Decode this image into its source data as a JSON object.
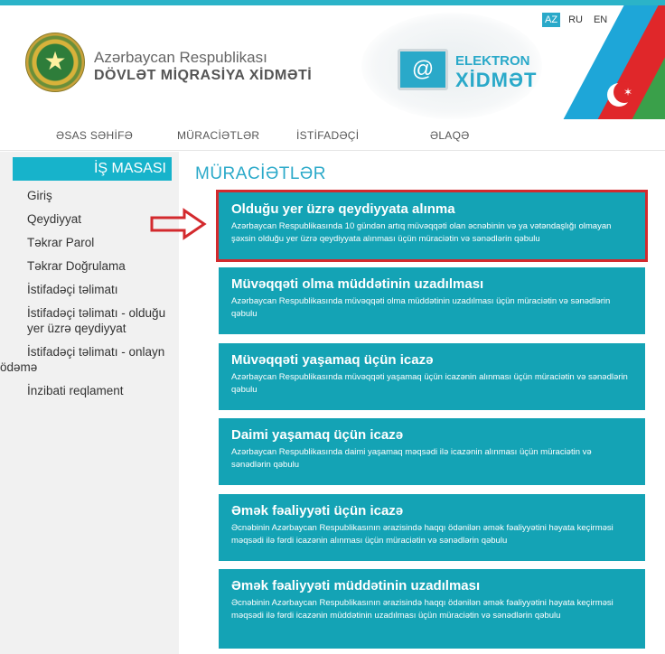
{
  "header": {
    "org_line1": "Azərbaycan Respublikası",
    "org_line2": "DÖVLƏT MİQRASİYA XİDMƏTİ",
    "elektron_line1": "ELEKTRON",
    "elektron_line2": "XİDMƏT",
    "monitor_symbol": "@",
    "languages": [
      "AZ",
      "RU",
      "EN"
    ],
    "active_language": "AZ",
    "flag_colors": [
      "#1ea6d8",
      "#e0272a",
      "#3aa04a"
    ]
  },
  "nav": {
    "items": [
      "ƏSAS SƏHİFƏ",
      "MÜRACİƏTLƏR",
      "İSTİFADƏÇİ",
      "ƏLAQƏ"
    ]
  },
  "sidebar": {
    "title": "İŞ MASASI",
    "items": [
      {
        "label": "Giriş"
      },
      {
        "label": "Qeydiyyat"
      },
      {
        "label": "Təkrar Parol"
      },
      {
        "label": "Təkrar Doğrulama"
      },
      {
        "label": "İstifadəçi təlimatı"
      },
      {
        "label": "İstifadəçi təlimatı - olduğu yer üzrə qeydiyyat"
      },
      {
        "label": "İstifadəçi təlimatı - onlayn ödəmə"
      },
      {
        "label": "İnzibati reqlament"
      }
    ]
  },
  "main": {
    "title": "MÜRACİƏTLƏR",
    "cards": [
      {
        "title": "Olduğu yer üzrə qeydiyyata alınma",
        "desc": "Azərbaycan Respublikasında 10 gündən artıq müvəqqəti olan əcnəbinin və ya vətəndaşlığı olmayan şəxsin olduğu yer üzrə qeydiyyata alınması üçün müraciətin və sənədlərin qəbulu"
      },
      {
        "title": "Müvəqqəti olma müddətinin uzadılması",
        "desc": "Azərbaycan Respublikasında müvəqqəti olma müddətinin uzadılması üçün müraciətin və sənədlərin qəbulu"
      },
      {
        "title": "Müvəqqəti yaşamaq üçün icazə",
        "desc": "Azərbaycan Respublikasında müvəqqəti yaşamaq üçün icazənin alınması üçün müraciətin və sənədlərin qəbulu"
      },
      {
        "title": "Daimi yaşamaq üçün icazə",
        "desc": "Azərbaycan Respublikasında daimi yaşamaq məqsədi ilə icazənin alınması üçün müraciətin və sənədlərin qəbulu"
      },
      {
        "title": "Əmək fəaliyyəti üçün icazə",
        "desc": "Əcnəbinin Azərbaycan Respublikasının ərazisində haqqı ödənilən əmək fəaliyyətini həyata keçirməsi məqsədi ilə fərdi icazənin alınması üçün müraciətin və sənədlərin qəbulu"
      },
      {
        "title": "Əmək fəaliyyəti müddətinin uzadılması",
        "desc": "Əcnəbinin Azərbaycan Respublikasının ərazisində haqqı ödənilən əmək fəaliyyətini həyata keçirməsi məqsədi ilə fərdi icazənin müddətinin uzadılması üçün müraciətin və sənədlərin qəbulu"
      }
    ]
  },
  "colors": {
    "accent": "#2aa9c9",
    "card": "#14a3b5",
    "highlight": "#d32a2e"
  }
}
